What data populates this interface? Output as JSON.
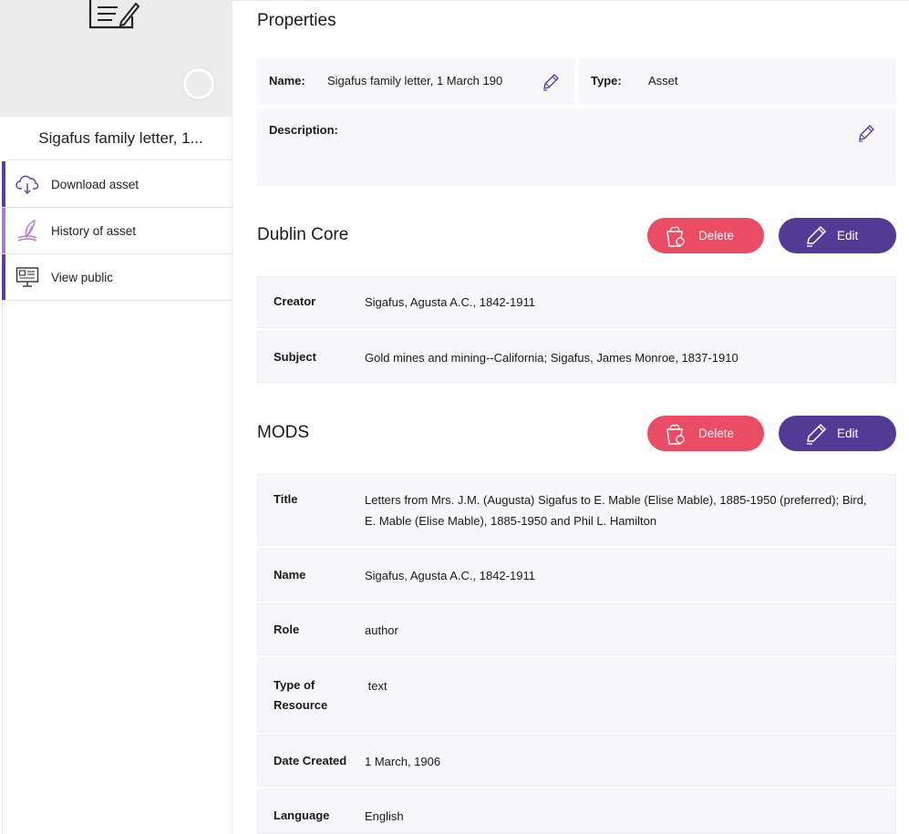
{
  "sidebar": {
    "asset_title": "Sigafus family letter, 1...",
    "items": [
      {
        "label": "Download asset",
        "icon": "cloud-download-icon"
      },
      {
        "label": "History of asset",
        "icon": "quill-history-icon"
      },
      {
        "label": "View public",
        "icon": "monitor-icon"
      }
    ]
  },
  "properties": {
    "title": "Properties",
    "name_label": "Name:",
    "name_value": "Sigafus family letter, 1 March 190",
    "type_label": "Type:",
    "type_value": "Asset",
    "description_label": "Description:",
    "description_value": ""
  },
  "dublin_core": {
    "title": "Dublin Core",
    "delete_label": "Delete",
    "edit_label": "Edit",
    "rows": [
      {
        "key": "Creator",
        "value": "Sigafus, Agusta A.C., 1842-1911"
      },
      {
        "key": "Subject",
        "value": "Gold mines and mining--California; Sigafus, James Monroe, 1837-1910"
      }
    ]
  },
  "mods": {
    "title": "MODS",
    "delete_label": "Delete",
    "edit_label": "Edit",
    "rows": [
      {
        "key": "Title",
        "value": "Letters from Mrs. J.M. (Augusta) Sigafus to E. Mable (Elise Mable), 1885-1950 (preferred); Bird, E. Mable (Elise Mable), 1885-1950 and Phil L. Hamilton"
      },
      {
        "key": "Name",
        "value": "Sigafus, Agusta A.C., 1842-1911"
      },
      {
        "key": "Role",
        "value": "author"
      },
      {
        "key": "Type of Resource",
        "value": " text"
      },
      {
        "key": "Date Created",
        "value": "1 March, 1906"
      },
      {
        "key": "Language",
        "value": "English"
      }
    ]
  },
  "colors": {
    "accent_purple": "#533a95",
    "delete_red": "#ea4c63",
    "panel_bg": "#f7f7f9"
  }
}
